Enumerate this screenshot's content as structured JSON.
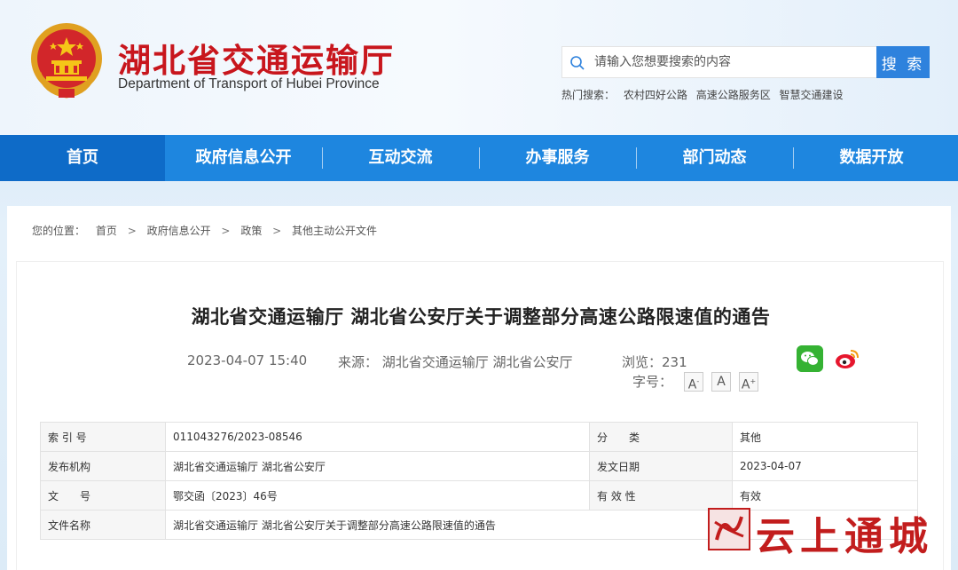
{
  "header": {
    "title": "湖北省交通运输厅",
    "subtitle": "Department of Transport of Hubei Province"
  },
  "search": {
    "placeholder": "请输入您想要搜索的内容",
    "button": "搜 索",
    "hot_label": "热门搜索：",
    "hot_items": [
      "农村四好公路",
      "高速公路服务区",
      "智慧交通建设"
    ]
  },
  "nav": {
    "items": [
      "首页",
      "政府信息公开",
      "互动交流",
      "办事服务",
      "部门动态",
      "数据开放"
    ]
  },
  "breadcrumb": {
    "label": "您的位置：",
    "items": [
      "首页",
      "政府信息公开",
      "政策",
      "其他主动公开文件"
    ],
    "separator": ">"
  },
  "article": {
    "title": "湖北省交通运输厅 湖北省公安厅关于调整部分高速公路限速值的通告",
    "date": "2023-04-07 15:40",
    "source": "来源：  湖北省交通运输厅 湖北省公安厅",
    "views": "浏览：231",
    "font_size_label": "字号：",
    "font_buttons": [
      "A",
      "A",
      "A"
    ]
  },
  "info_table": {
    "rows": [
      [
        "索 引 号",
        "011043276/2023-08546",
        "分　　类",
        "其他"
      ],
      [
        "发布机构",
        "湖北省交通运输厅 湖北省公安厅",
        "发文日期",
        "2023-04-07"
      ],
      [
        "文　　号",
        "鄂交函〔2023〕46号",
        "有 效 性",
        "有效"
      ],
      [
        "文件名称",
        "湖北省交通运输厅 湖北省公安厅关于调整部分高速公路限速值的通告",
        "",
        ""
      ]
    ]
  },
  "watermark": {
    "text": "云上通城",
    "seal_text": "通城"
  },
  "colors": {
    "brand_red": "#c8161d",
    "nav_blue": "#1e86df",
    "nav_active": "#0e6bc8",
    "search_blue": "#2e82dd"
  }
}
